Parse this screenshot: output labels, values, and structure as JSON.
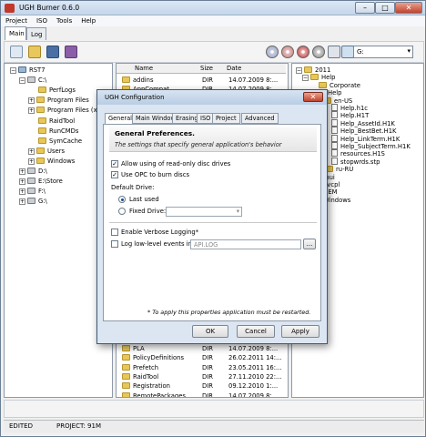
{
  "window": {
    "title": "UGH Burner 0.6.0",
    "min": "–",
    "max": "□",
    "close": "✕"
  },
  "menu": [
    "Project",
    "ISO",
    "Tools",
    "Help"
  ],
  "tabs": [
    "Main",
    "Log"
  ],
  "toolbar": {
    "drive_value": "G:",
    "icons": [
      "new-project-icon",
      "open-project-icon",
      "save-project-icon",
      "edit-icon",
      "burn-cd-icon",
      "burn-dvd-icon",
      "copy-disc-icon",
      "erase-disc-icon",
      "eject-icon",
      "drive-info-icon"
    ]
  },
  "left_tree": [
    {
      "label": "RST7",
      "indent": 0,
      "exp": "−",
      "type": "pc"
    },
    {
      "label": "C:\\",
      "indent": 1,
      "exp": "−",
      "type": "drive"
    },
    {
      "label": "PerfLogs",
      "indent": 2,
      "exp": "",
      "type": "folder"
    },
    {
      "label": "Program Files",
      "indent": 2,
      "exp": "+",
      "type": "folder"
    },
    {
      "label": "Program Files (x",
      "indent": 2,
      "exp": "+",
      "type": "folder"
    },
    {
      "label": "RaidTool",
      "indent": 2,
      "exp": "",
      "type": "folder"
    },
    {
      "label": "RunCMDs",
      "indent": 2,
      "exp": "",
      "type": "folder"
    },
    {
      "label": "SymCache",
      "indent": 2,
      "exp": "",
      "type": "folder"
    },
    {
      "label": "Users",
      "indent": 2,
      "exp": "+",
      "type": "folder"
    },
    {
      "label": "Windows",
      "indent": 2,
      "exp": "+",
      "type": "folder"
    },
    {
      "label": "D:\\",
      "indent": 1,
      "exp": "+",
      "type": "drive"
    },
    {
      "label": "E:\\Store",
      "indent": 1,
      "exp": "+",
      "type": "drive"
    },
    {
      "label": "F:\\",
      "indent": 1,
      "exp": "+",
      "type": "drive"
    },
    {
      "label": "G:\\",
      "indent": 1,
      "exp": "+",
      "type": "drive"
    }
  ],
  "file_list": {
    "headers": {
      "name": "Name",
      "size": "Size",
      "date": "Date"
    },
    "top_rows": [
      {
        "name": "addins",
        "size": "DIR",
        "date": "14.07.2009 8:..."
      },
      {
        "name": "AppCompat",
        "size": "DIR",
        "date": "14.07.2009 8:..."
      }
    ],
    "bottom_rows": [
      {
        "name": "PLA",
        "size": "DIR",
        "date": "14.07.2009 8:..."
      },
      {
        "name": "PolicyDefinitions",
        "size": "DIR",
        "date": "26.02.2011 14:..."
      },
      {
        "name": "Prefetch",
        "size": "DIR",
        "date": "23.05.2011 16:..."
      },
      {
        "name": "RaidTool",
        "size": "DIR",
        "date": "27.11.2010 22:..."
      },
      {
        "name": "Registration",
        "size": "DIR",
        "date": "09.12.2010 1:..."
      },
      {
        "name": "RemotePackages",
        "size": "DIR",
        "date": "14.07.2009 8:..."
      }
    ]
  },
  "right_tree": [
    {
      "label": "2011",
      "indent": 0,
      "exp": "−",
      "type": "folder"
    },
    {
      "label": "Help",
      "indent": 1,
      "exp": "−",
      "type": "folder"
    },
    {
      "label": "Corporate",
      "indent": 2,
      "exp": "",
      "type": "folder"
    },
    {
      "label": "Help",
      "indent": 2,
      "exp": "−",
      "type": "folder"
    },
    {
      "label": "en-US",
      "indent": 3,
      "exp": "−",
      "type": "folder"
    },
    {
      "label": "Help.h1c",
      "indent": 4,
      "exp": "",
      "type": "file"
    },
    {
      "label": "Help.H1T",
      "indent": 4,
      "exp": "",
      "type": "file"
    },
    {
      "label": "Help_AssetId.H1K",
      "indent": 4,
      "exp": "",
      "type": "file"
    },
    {
      "label": "Help_BestBet.H1K",
      "indent": 4,
      "exp": "",
      "type": "file"
    },
    {
      "label": "Help_LinkTerm.H1K",
      "indent": 4,
      "exp": "",
      "type": "file"
    },
    {
      "label": "Help_SubjectTerm.H1K",
      "indent": 4,
      "exp": "",
      "type": "file"
    },
    {
      "label": "resources.H1S",
      "indent": 4,
      "exp": "",
      "type": "file"
    },
    {
      "label": "stopwrds.stp",
      "indent": 4,
      "exp": "",
      "type": "file"
    },
    {
      "label": "ru-RU",
      "indent": 3,
      "exp": "",
      "type": "folder"
    },
    {
      "label": "mui",
      "indent": 1,
      "exp": "",
      "type": "folder"
    },
    {
      "label": "nvcpl",
      "indent": 1,
      "exp": "",
      "type": "folder"
    },
    {
      "label": "OEM",
      "indent": 1,
      "exp": "",
      "type": "folder"
    },
    {
      "label": "Windows",
      "indent": 1,
      "exp": "",
      "type": "folder"
    }
  ],
  "status": {
    "left": "EDITED",
    "project": "PROJECT: 91M"
  },
  "dialog": {
    "title": "UGH Configuration",
    "close": "✕",
    "tabs": [
      "General",
      "Main Window",
      "Erasing",
      "ISO",
      "Project",
      "Advanced"
    ],
    "heading": "General Preferences.",
    "subheading": "The settings that specify general application's behavior",
    "cb_readonly": "Allow using of read-only disc drives",
    "cb_opc": "Use OPC to burn discs",
    "default_drive_label": "Default Drive:",
    "radio_last": "Last used",
    "radio_fixed": "Fixed Drive:",
    "cb_verbose": "Enable Verbose Logging*",
    "cb_lowlevel": "Log low-level events in*:",
    "log_path": "API.LOG",
    "browse": "...",
    "note": "* To apply this properties application must be restarted.",
    "ok": "OK",
    "cancel": "Cancel",
    "apply": "Apply"
  }
}
